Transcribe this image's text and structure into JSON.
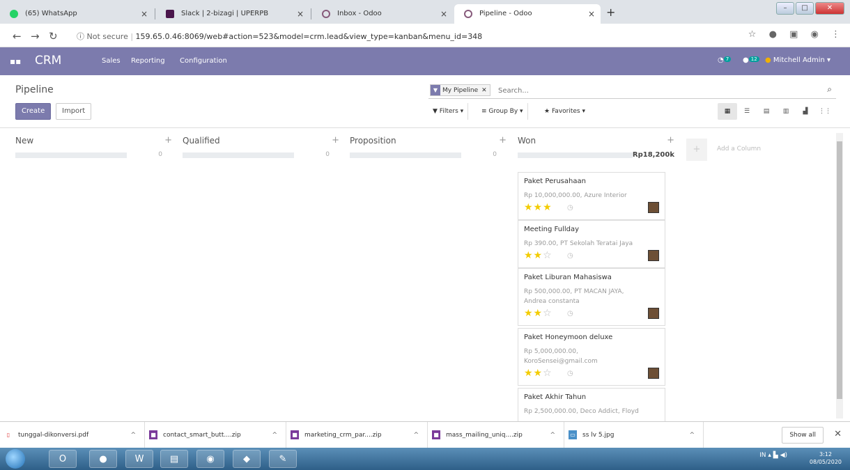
{
  "browser": {
    "tabs": [
      {
        "title": "(65) WhatsApp",
        "color": "#25d366"
      },
      {
        "title": "Slack | 2-bizagi | UPERPB",
        "color": "#4a154b"
      },
      {
        "title": "Inbox - Odoo",
        "color": "#875a7b"
      },
      {
        "title": "Pipeline - Odoo",
        "color": "#875a7b"
      }
    ],
    "tab_close": "×",
    "new_tab": "+",
    "url_not_secure": "Not secure",
    "url": "159.65.0.46:8069/web#action=523&model=crm.lead&view_type=kanban&menu_id=348"
  },
  "navbar": {
    "bg_color": "#7c7bad",
    "brand": "CRM",
    "menu": [
      "Sales",
      "Reporting",
      "Configuration"
    ],
    "activity_count": "7",
    "message_count": "12",
    "user": "Mitchell Admin"
  },
  "control_panel": {
    "breadcrumb": "Pipeline",
    "create_label": "Create",
    "import_label": "Import",
    "facet_label": "My Pipeline",
    "search_placeholder": "Search...",
    "filters_label": "Filters",
    "groupby_label": "Group By",
    "favorites_label": "Favorites"
  },
  "kanban": {
    "columns": [
      {
        "title": "New",
        "count": "0"
      },
      {
        "title": "Qualified",
        "count": "0"
      },
      {
        "title": "Proposition",
        "count": "0"
      },
      {
        "title": "Won",
        "total": "Rp18,200k"
      }
    ],
    "add_column_label": "Add a Column",
    "cards": [
      {
        "name": "Paket Perusahaan",
        "line1": "Rp 10,000,000.00, Azure Interior",
        "line2": "",
        "stars": 3
      },
      {
        "name": "Meeting Fullday",
        "line1": "Rp 390.00, PT Sekolah Teratai Jaya",
        "line2": "",
        "stars": 2
      },
      {
        "name": "Paket Liburan Mahasiswa",
        "line1": "Rp 500,000.00, PT MACAN JAYA,",
        "line2": "Andrea constanta",
        "stars": 2
      },
      {
        "name": "Paket Honeymoon deluxe",
        "line1": "Rp 5,000,000.00,",
        "line2": "KoroSensei@gmail.com",
        "stars": 2
      },
      {
        "name": "Paket Akhir Tahun",
        "line1": "Rp 2,500,000.00, Deco Addict, Floyd",
        "line2": "",
        "stars": 0
      }
    ]
  },
  "downloads": {
    "items": [
      "tunggal-dikonversi.pdf",
      "contact_smart_butt....zip",
      "marketing_crm_par....zip",
      "mass_mailing_uniq....zip",
      "ss lv 5.jpg"
    ],
    "show_all": "Show all"
  },
  "taskbar": {
    "time": "3:12",
    "date": "08/05/2020",
    "lang": "IN"
  }
}
